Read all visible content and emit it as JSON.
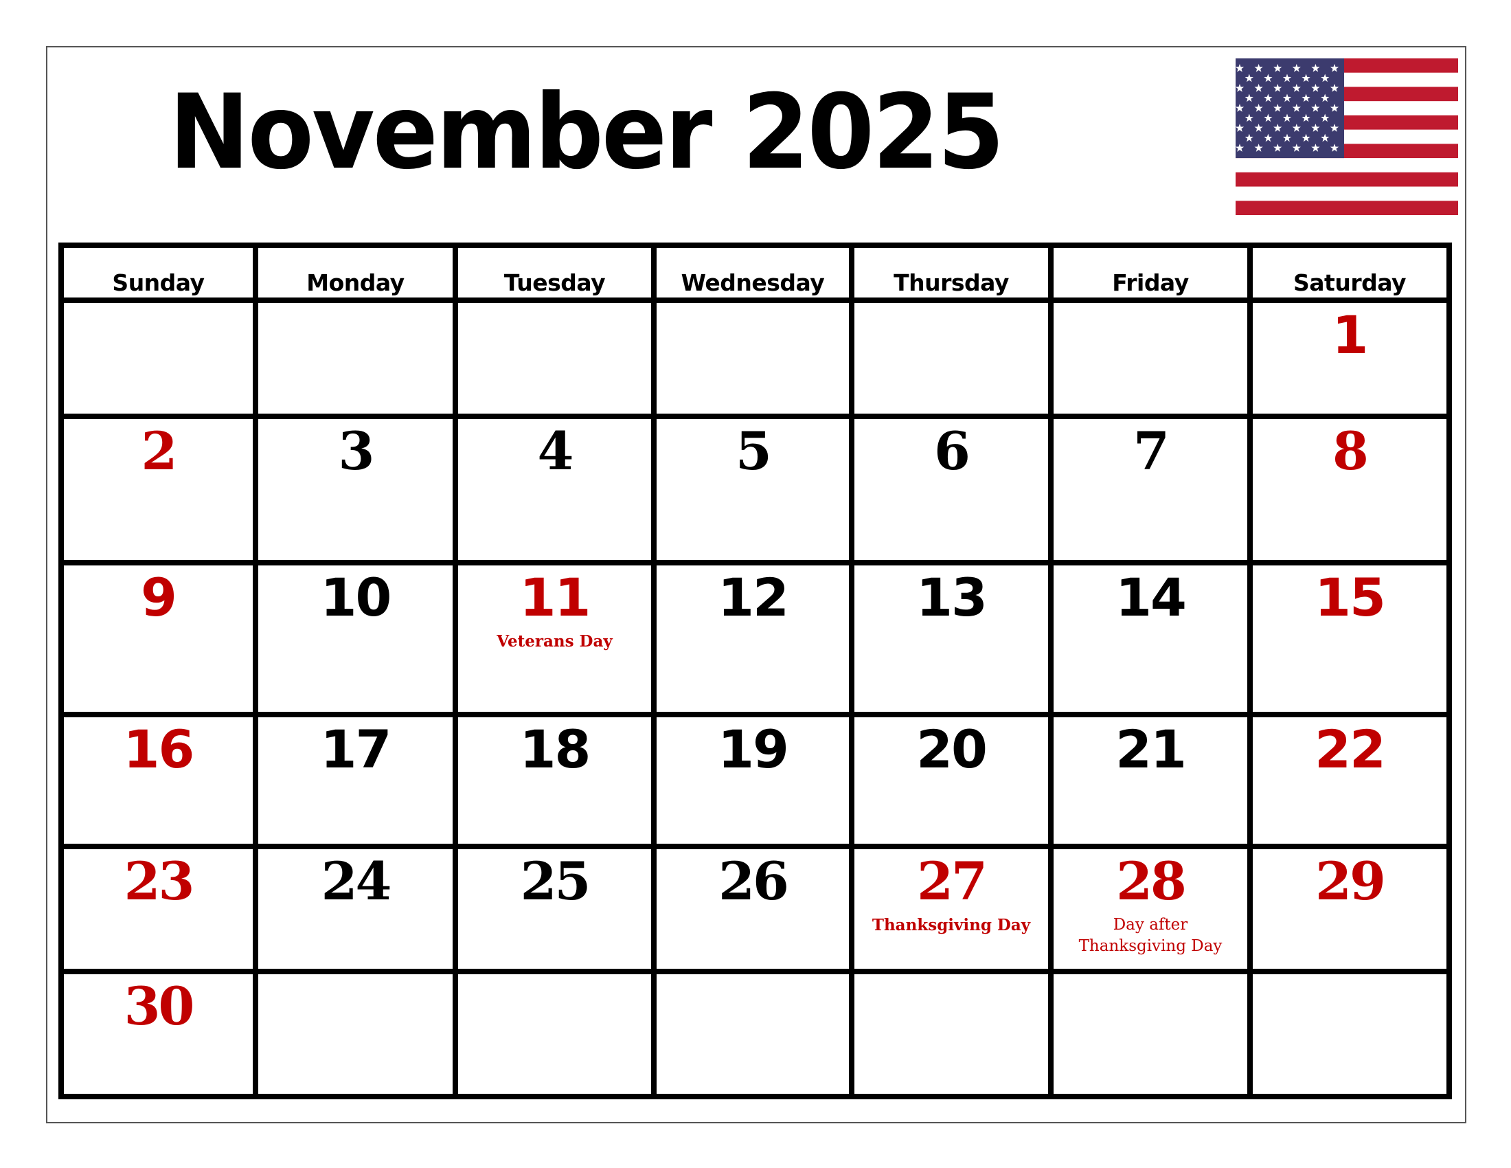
{
  "title": "November 2025",
  "flag": {
    "name": "United States flag",
    "colors": {
      "red": "#BF1A2F",
      "white": "#FFFFFF",
      "blue": "#3C3B6E"
    }
  },
  "accent_color": "#C00000",
  "weekdays": [
    "Sunday",
    "Monday",
    "Tuesday",
    "Wednesday",
    "Thursday",
    "Friday",
    "Saturday"
  ],
  "weeks": [
    [
      {
        "day": ""
      },
      {
        "day": ""
      },
      {
        "day": ""
      },
      {
        "day": ""
      },
      {
        "day": ""
      },
      {
        "day": ""
      },
      {
        "day": "1",
        "red": true
      }
    ],
    [
      {
        "day": "2",
        "red": true
      },
      {
        "day": "3"
      },
      {
        "day": "4"
      },
      {
        "day": "5"
      },
      {
        "day": "6"
      },
      {
        "day": "7"
      },
      {
        "day": "8",
        "red": true
      }
    ],
    [
      {
        "day": "9",
        "red": true
      },
      {
        "day": "10"
      },
      {
        "day": "11",
        "red": true,
        "holiday": "Veterans Day",
        "holiday_bold": true
      },
      {
        "day": "12"
      },
      {
        "day": "13"
      },
      {
        "day": "14"
      },
      {
        "day": "15",
        "red": true
      }
    ],
    [
      {
        "day": "16",
        "red": true
      },
      {
        "day": "17"
      },
      {
        "day": "18"
      },
      {
        "day": "19"
      },
      {
        "day": "20"
      },
      {
        "day": "21"
      },
      {
        "day": "22",
        "red": true
      }
    ],
    [
      {
        "day": "23",
        "red": true
      },
      {
        "day": "24"
      },
      {
        "day": "25"
      },
      {
        "day": "26"
      },
      {
        "day": "27",
        "red": true,
        "holiday": "Thanksgiving Day",
        "holiday_bold": true
      },
      {
        "day": "28",
        "red": true,
        "holiday": "Day after Thanksgiving Day",
        "holiday_lines": [
          "Day after",
          "Thanksgiving Day"
        ],
        "holiday_bold": false
      },
      {
        "day": "29",
        "red": true
      }
    ],
    [
      {
        "day": "30",
        "red": true
      },
      {
        "day": ""
      },
      {
        "day": ""
      },
      {
        "day": ""
      },
      {
        "day": ""
      },
      {
        "day": ""
      },
      {
        "day": ""
      }
    ]
  ]
}
